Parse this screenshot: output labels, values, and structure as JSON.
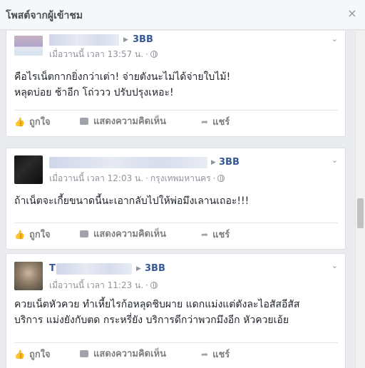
{
  "dialog": {
    "title": "โพสต์จากผู้เข้าชม",
    "close_icon": "×"
  },
  "colors": {
    "link": "#365899",
    "meta": "#90949c",
    "text": "#1d2129",
    "background": "#e9ebee"
  },
  "actions": {
    "like": "ถูกใจ",
    "comment": "แสดงความคิดเห็น",
    "share": "แชร์"
  },
  "posts": [
    {
      "page": "3BB",
      "name_initial": "",
      "timestamp": "เมื่อวานนี้ เวลา 13:57 น.",
      "location": "",
      "text": "คือไรเน็ตกากยิ่งกว่าเต่า! จ่ายตังนะไม่ได้จ่ายใบไม้!\nหลุดบ่อย ช้าอีก โถ่ววว ปรับปรุงเหอะ!"
    },
    {
      "page": "3BB",
      "name_initial": "",
      "timestamp": "เมื่อวานนี้ เวลา 12:03 น.",
      "location": "กรุงเทพมหานคร",
      "text": "ถ้าเน็ตจะเกี้ยขนาดนี้นะเอากลับไปให้พ่อมึงเลานเถอะ!!!"
    },
    {
      "page": "3BB",
      "name_initial": "T",
      "timestamp": "เมื่อวานนี้ เวลา 11:23 น.",
      "location": "",
      "text": "ควยเน็ตหัวควย ทำเหี้ยไรก้อหลุดชิบผาย แดกแม่งแต่ตังละไอสัสอีสัส\nบริการ แม่งยังกับตด กระหรี่ยัง บริการดีกว่าพวกมึงอีก หัวควยเอ้ย"
    }
  ]
}
